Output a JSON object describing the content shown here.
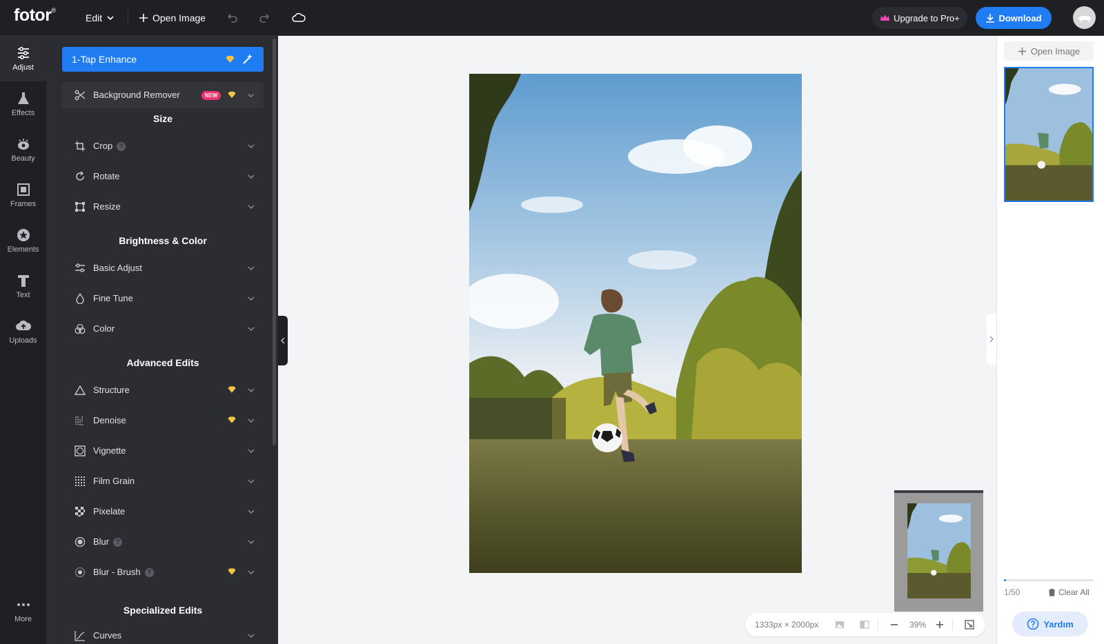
{
  "topbar": {
    "logo": "fotor",
    "logo_mark": "®",
    "edit_label": "Edit",
    "open_image_label": "Open Image",
    "upgrade_label": "Upgrade to Pro+",
    "download_label": "Download"
  },
  "rail": [
    {
      "label": "Adjust",
      "icon": "sliders-icon",
      "active": true
    },
    {
      "label": "Effects",
      "icon": "flask-icon"
    },
    {
      "label": "Beauty",
      "icon": "eye-icon"
    },
    {
      "label": "Frames",
      "icon": "frame-icon"
    },
    {
      "label": "Elements",
      "icon": "star-icon"
    },
    {
      "label": "Text",
      "icon": "text-icon"
    },
    {
      "label": "Uploads",
      "icon": "cloud-upload-icon"
    }
  ],
  "rail_more": "More",
  "panel": {
    "enhance_label": "1-Tap Enhance",
    "bg_remover_label": "Background Remover",
    "new_badge": "NEW",
    "sections": {
      "size": "Size",
      "brightness": "Brightness & Color",
      "advanced": "Advanced Edits",
      "specialized": "Specialized Edits"
    },
    "tools": {
      "crop": "Crop",
      "rotate": "Rotate",
      "resize": "Resize",
      "basic_adjust": "Basic Adjust",
      "fine_tune": "Fine Tune",
      "color": "Color",
      "structure": "Structure",
      "denoise": "Denoise",
      "vignette": "Vignette",
      "film_grain": "Film Grain",
      "pixelate": "Pixelate",
      "blur": "Blur",
      "blur_brush": "Blur - Brush",
      "curves": "Curves"
    }
  },
  "right_panel": {
    "open_image_label": "Open Image",
    "count": "1/50",
    "clear_all": "Clear All",
    "help_label": "Yardım",
    "progress": 0.02
  },
  "status": {
    "dimensions": "1333px × 2000px",
    "zoom": "39%"
  },
  "colors": {
    "accent": "#1f7cf2",
    "dark": "#1f2024",
    "panel": "#2c2d33",
    "gem": "#f5c542",
    "new_badge": "#f0336b"
  }
}
